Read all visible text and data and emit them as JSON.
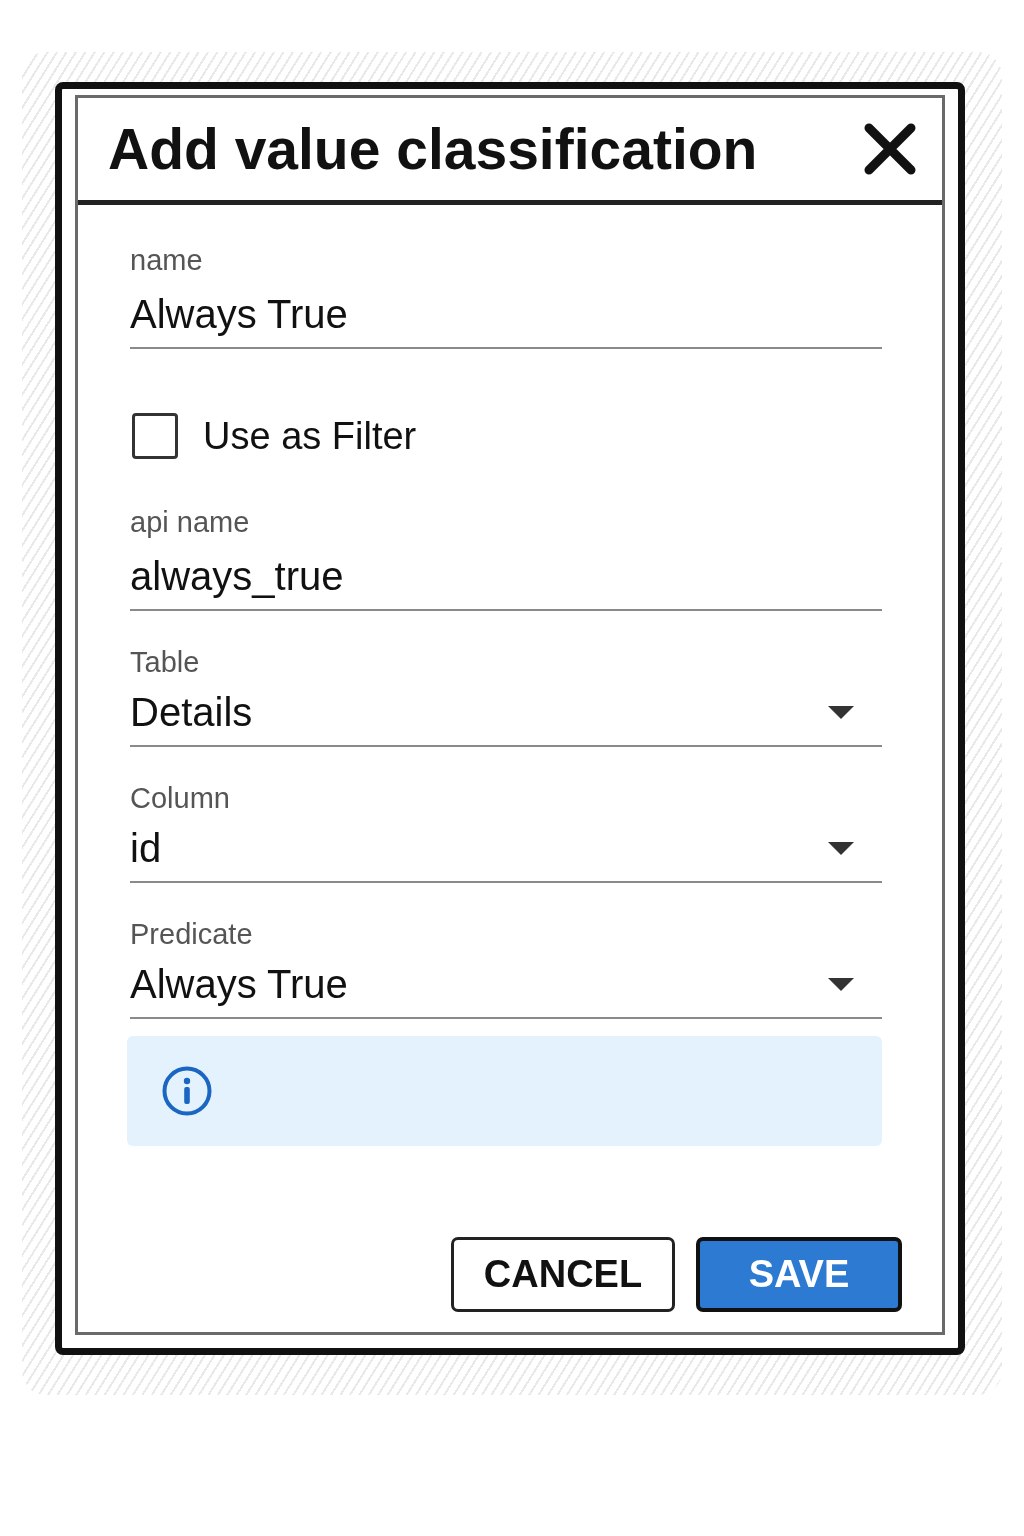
{
  "dialog": {
    "title": "Add value classification",
    "fields": [
      {
        "kind": "text",
        "label": "name",
        "value": "Always True"
      },
      {
        "kind": "checkbox",
        "label": "Use as Filter",
        "checked": false
      },
      {
        "kind": "text",
        "label": "api name",
        "value": "always_true"
      },
      {
        "kind": "select",
        "label": "Table",
        "value": "Details"
      },
      {
        "kind": "select",
        "label": "Column",
        "value": "id"
      },
      {
        "kind": "select",
        "label": "Predicate",
        "value": "Always True"
      },
      {
        "kind": "info"
      }
    ],
    "buttons": [
      {
        "kind": "secondary",
        "label": "CANCEL"
      },
      {
        "kind": "primary",
        "label": "SAVE"
      }
    ]
  }
}
